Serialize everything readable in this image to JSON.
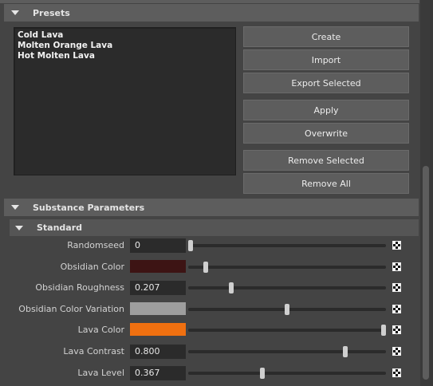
{
  "presets": {
    "title": "Presets",
    "items": [
      "Cold Lava",
      "Molten Orange Lava",
      "Hot Molten Lava"
    ],
    "buttons": {
      "create": "Create",
      "import": "Import",
      "export_selected": "Export Selected",
      "apply": "Apply",
      "overwrite": "Overwrite",
      "remove_selected": "Remove Selected",
      "remove_all": "Remove All"
    }
  },
  "substance": {
    "title": "Substance Parameters",
    "standard": {
      "title": "Standard",
      "params": [
        {
          "label": "Randomseed",
          "value": "0",
          "slider": 0.0
        },
        {
          "label": "Obsidian Color",
          "color": "#3d1414",
          "slider": 0.08
        },
        {
          "label": "Obsidian Roughness",
          "value": "0.207",
          "slider": 0.21
        },
        {
          "label": "Obsidian Color Variation",
          "color": "#9e9e9e",
          "slider": 0.5
        },
        {
          "label": "Lava Color",
          "color": "#f07010",
          "slider": 1.0
        },
        {
          "label": "Lava Contrast",
          "value": "0.800",
          "slider": 0.8
        },
        {
          "label": "Lava Level",
          "value": "0.367",
          "slider": 0.37
        }
      ]
    }
  },
  "icons": {
    "collapse": "triangle-down-icon",
    "map": "checker-map-icon"
  }
}
